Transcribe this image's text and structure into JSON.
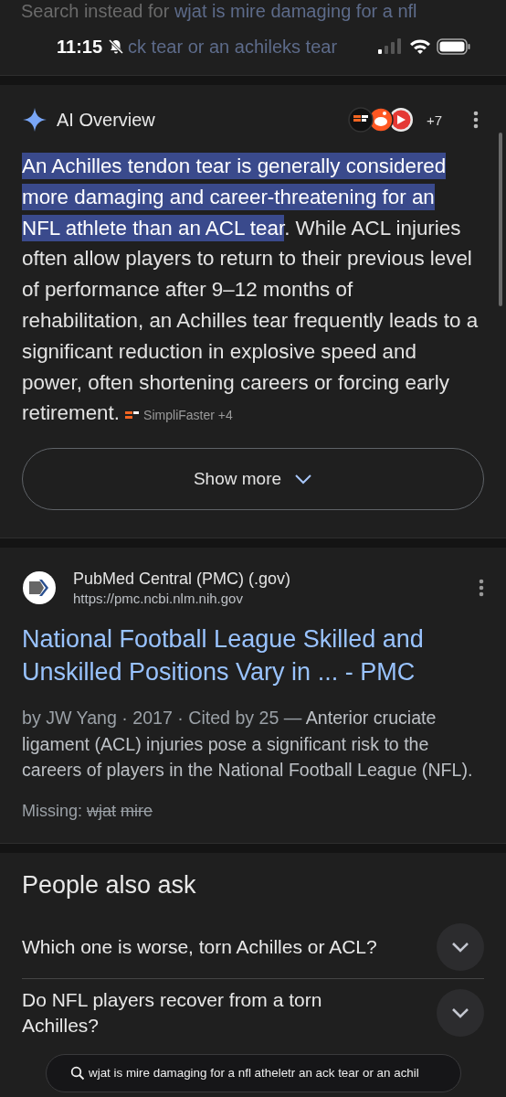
{
  "search_instead": {
    "label": "Search instead for",
    "query": "wjat is mire damaging for a nfl",
    "query_continued": "ck tear or an achileks tear"
  },
  "status_bar": {
    "time": "11:15"
  },
  "ai_overview": {
    "title": "AI Overview",
    "source_count": "+7",
    "highlight": "An Achilles tendon tear is generally considered more damaging and career-threatening for an NFL athlete than an ACL tear",
    "text": ". While ACL injuries often allow players to return to their previous level of performance after 9–12 months of rehabilitation, an Achilles tear frequently leads to a significant reduction in explosive speed and power, often shortening careers or forcing early retirement.",
    "citation": "SimpliFaster +4",
    "show_more": "Show more"
  },
  "result": {
    "site": "PubMed Central (PMC) (.gov)",
    "url": "https://pmc.ncbi.nlm.nih.gov",
    "title": "National Football League Skilled and Unskilled Positions Vary in ... - PMC",
    "meta": "by JW Yang · 2017 · Cited by 25 —",
    "snippet": "Anterior cruciate ligament (ACL) injuries pose a significant risk to the careers of players in the National Football League (NFL).",
    "missing_label": "Missing:",
    "missing_terms": [
      "wjat",
      "mire"
    ]
  },
  "people_also_ask": {
    "title": "People also ask",
    "questions": [
      {
        "text": "Which one is worse, torn Achilles or ACL?",
        "expanded": false
      },
      {
        "text": "Do NFL players recover from a torn Achilles?",
        "expanded": false
      }
    ]
  },
  "floating_search": {
    "query": "wjat is mire damaging for a nfl atheletr an ack tear or an achil"
  }
}
